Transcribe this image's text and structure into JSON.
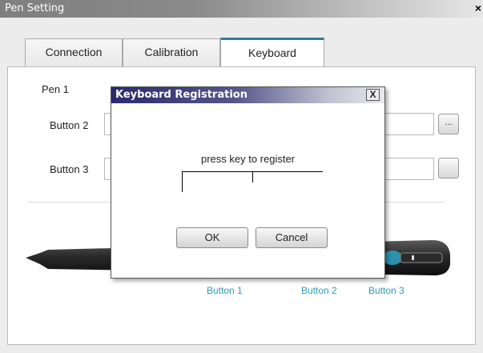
{
  "window": {
    "title": "Pen Setting",
    "close_glyph": "×"
  },
  "tabs": [
    {
      "label": "Connection"
    },
    {
      "label": "Calibration"
    },
    {
      "label": "Keyboard"
    }
  ],
  "content": {
    "pen_label": "Pen 1",
    "button2_label": "Button 2",
    "button3_label": "Button 3",
    "browse_glyph": "...",
    "captions": [
      "Button 1",
      "Button 2",
      "Button 3"
    ]
  },
  "dialog": {
    "title": "Keyboard Registration",
    "close_glyph": "X",
    "prompt": "press key to register",
    "ok_label": "OK",
    "cancel_label": "Cancel"
  },
  "colors": {
    "accent": "#2f7f8f",
    "caption": "#2d9bb8",
    "modal_title": "#2a2a6e"
  }
}
